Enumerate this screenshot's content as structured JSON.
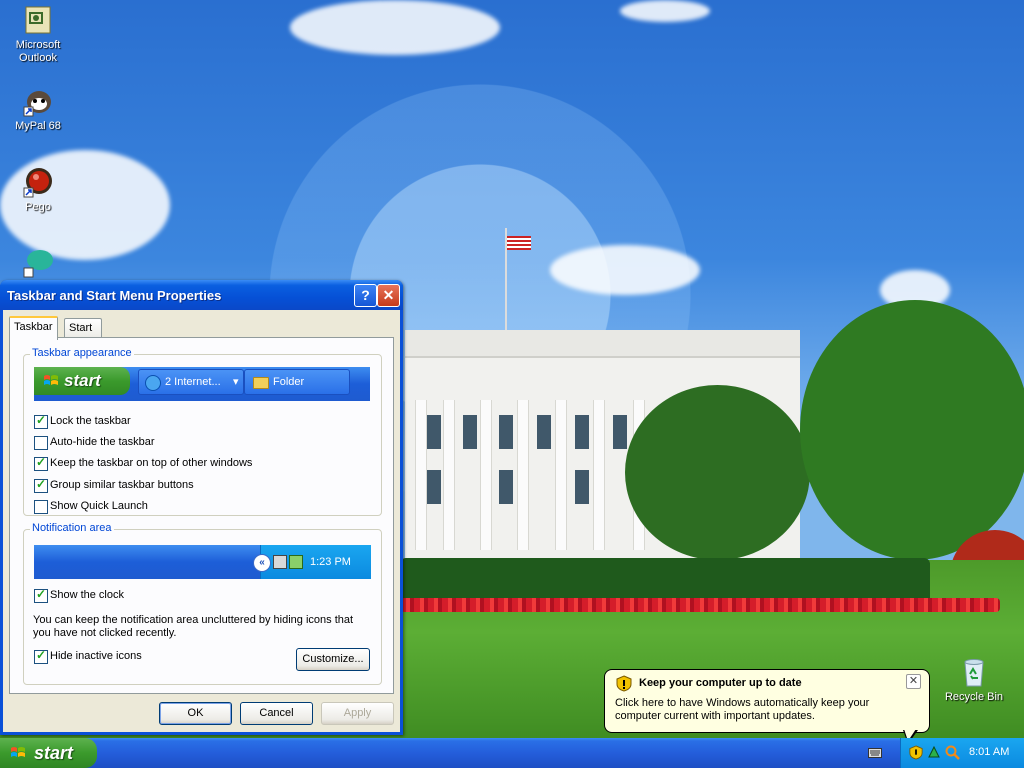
{
  "desktop": {
    "icons": [
      {
        "label": "Microsoft\nOutlook",
        "icon": "outlook-icon"
      },
      {
        "label": "MyPal 68",
        "icon": "mypal-icon"
      },
      {
        "label": "Pego",
        "icon": "pego-icon"
      },
      {
        "label": "",
        "icon": "app-icon"
      },
      {
        "label": "Recycle Bin",
        "icon": "recycle-bin-icon"
      }
    ]
  },
  "dialog": {
    "title": "Taskbar and Start Menu Properties",
    "help_button": "?",
    "close_button": "✕",
    "tabs": [
      {
        "label": "Taskbar",
        "active": true
      },
      {
        "label": "Start Menu",
        "active": false
      }
    ],
    "appearance": {
      "group_label": "Taskbar appearance",
      "preview": {
        "start_label": "start",
        "buttons": [
          {
            "label": "2 Internet...",
            "icon": "internet-explorer-icon",
            "dropdown": "▾"
          },
          {
            "label": "Folder",
            "icon": "folder-icon"
          }
        ]
      },
      "options": [
        {
          "label": "Lock the taskbar",
          "checked": true
        },
        {
          "label": "Auto-hide the taskbar",
          "checked": false
        },
        {
          "label": "Keep the taskbar on top of other windows",
          "checked": true
        },
        {
          "label": "Group similar taskbar buttons",
          "checked": true
        },
        {
          "label": "Show Quick Launch",
          "checked": false
        }
      ]
    },
    "notification": {
      "group_label": "Notification area",
      "preview_time": "1:23 PM",
      "chevron": "«",
      "show_clock_label": "Show the clock",
      "show_clock_checked": true,
      "description": "You can keep the notification area uncluttered by hiding icons that you have not clicked recently.",
      "hide_inactive_label": "Hide inactive icons",
      "hide_inactive_checked": true,
      "customize_button": "Customize..."
    },
    "buttons": {
      "ok": "OK",
      "cancel": "Cancel",
      "apply": "Apply"
    }
  },
  "balloon": {
    "title": "Keep your computer up to date",
    "body": "Click here to have Windows automatically keep your computer current with important updates.",
    "close": "✕"
  },
  "taskbar": {
    "start_label": "start",
    "clock": "8:01 AM",
    "tray_icons": [
      "keyboard-icon",
      "windows-update-shield-icon",
      "network-icon",
      "search-icon"
    ]
  },
  "colors": {
    "titlebar": "#0a5fe0",
    "start_green": "#3b9a2c",
    "group_label": "#0046d5",
    "dialog_face": "#ece9d8",
    "balloon_bg": "#ffffe1"
  }
}
